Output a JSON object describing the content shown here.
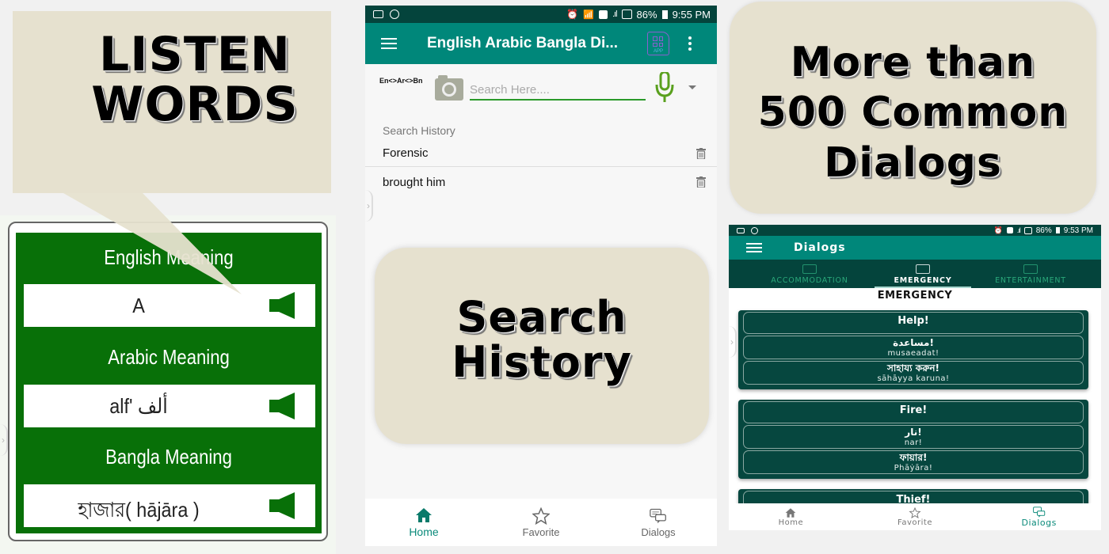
{
  "left_panel": {
    "promo_lines": [
      "LISTEN",
      "WORDS"
    ],
    "english_label": "English Meaning",
    "english_value": "A",
    "arabic_label": "Arabic Meaning",
    "arabic_value": "alf' ألف",
    "bangla_label": "Bangla Meaning",
    "bangla_value": "হাজার( hājāra )",
    "speaker_icon": "speaker-icon"
  },
  "middle_phone": {
    "status_bar": {
      "left_icons": [
        "image-icon",
        "assistant-icon"
      ],
      "right_icons": [
        "alarm-icon",
        "wifi-icon",
        "sim-2-icon",
        "signal-icon",
        "signal-icon"
      ],
      "battery": "86%",
      "time": "9:55 PM"
    },
    "app_bar": {
      "title": "English Arabic Bangla Di...",
      "app_icon_label": "APP"
    },
    "search": {
      "lang_toggle": "En<>Ar<>Bn",
      "placeholder": "Search Here...."
    },
    "history": {
      "heading": "Search History",
      "items": [
        "Forensic",
        "brought him"
      ]
    },
    "promo_lines": [
      "Search",
      "History"
    ],
    "bottom_nav": [
      {
        "label": "Home",
        "icon": "home-icon",
        "active": true
      },
      {
        "label": "Favorite",
        "icon": "star-icon",
        "active": false
      },
      {
        "label": "Dialogs",
        "icon": "chat-icon",
        "active": false
      }
    ]
  },
  "right_panel": {
    "promo_lines": [
      "More than",
      "500 Common",
      "Dialogs"
    ],
    "status_bar": {
      "battery": "86%",
      "time": "9:53 PM"
    },
    "app_bar": {
      "title": "Dialogs"
    },
    "tabs": [
      {
        "label": "ACCOMMODATION",
        "active": false
      },
      {
        "label": "EMERGENCY",
        "active": true
      },
      {
        "label": "ENTERTAINMENT",
        "active": false
      }
    ],
    "section_title": "EMERGENCY",
    "dialogs": [
      {
        "english": "Help!",
        "arabic": "مساعدة!",
        "arabic_translit": "musaeadat!",
        "bangla": "সাহায্য করুন!",
        "bangla_translit": "sāhāyya karuna!"
      },
      {
        "english": "Fire!",
        "arabic": "نار!",
        "arabic_translit": "nar!",
        "bangla": "ফায়ার!",
        "bangla_translit": "Phāẏāra!"
      },
      {
        "english": "Thief!"
      }
    ],
    "bottom_nav": [
      {
        "label": "Home",
        "active": false
      },
      {
        "label": "Favorite",
        "active": false
      },
      {
        "label": "Dialogs",
        "active": true
      }
    ]
  },
  "colors": {
    "teal_primary": "#00877a",
    "teal_dark": "#04443c",
    "green_card": "#087008",
    "promo_beige": "#e6e1cf",
    "search_underline": "#2a9a2a",
    "mic_green": "#5aa01e"
  }
}
